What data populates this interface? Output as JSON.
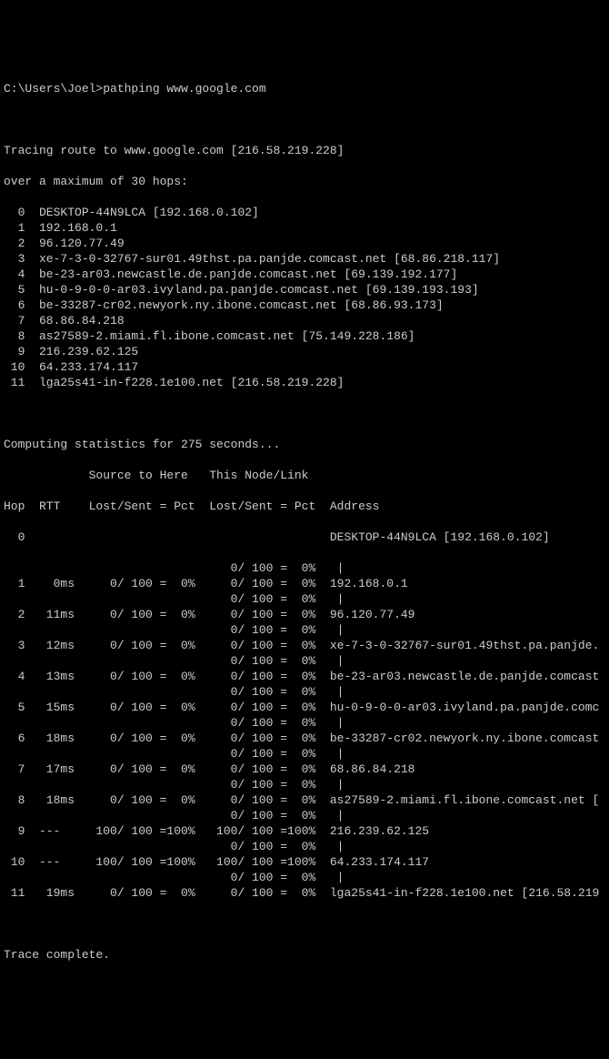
{
  "prompt": "C:\\Users\\Joel>pathping www.google.com",
  "trace_header": "Tracing route to www.google.com [216.58.219.228]",
  "maxhops": "over a maximum of 30 hops:",
  "trace_hops": [
    {
      "n": "  0",
      "text": "DESKTOP-44N9LCA [192.168.0.102]"
    },
    {
      "n": "  1",
      "text": "192.168.0.1"
    },
    {
      "n": "  2",
      "text": "96.120.77.49"
    },
    {
      "n": "  3",
      "text": "xe-7-3-0-32767-sur01.49thst.pa.panjde.comcast.net [68.86.218.117]"
    },
    {
      "n": "  4",
      "text": "be-23-ar03.newcastle.de.panjde.comcast.net [69.139.192.177]"
    },
    {
      "n": "  5",
      "text": "hu-0-9-0-0-ar03.ivyland.pa.panjde.comcast.net [69.139.193.193]"
    },
    {
      "n": "  6",
      "text": "be-33287-cr02.newyork.ny.ibone.comcast.net [68.86.93.173]"
    },
    {
      "n": "  7",
      "text": "68.86.84.218"
    },
    {
      "n": "  8",
      "text": "as27589-2.miami.fl.ibone.comcast.net [75.149.228.186]"
    },
    {
      "n": "  9",
      "text": "216.239.62.125"
    },
    {
      "n": " 10",
      "text": "64.233.174.117"
    },
    {
      "n": " 11",
      "text": "lga25s41-in-f228.1e100.net [216.58.219.228]"
    }
  ],
  "stats_header": "Computing statistics for 275 seconds...",
  "col_header1": "            Source to Here   This Node/Link",
  "col_header2": "Hop  RTT    Lost/Sent = Pct  Lost/Sent = Pct  Address",
  "hop0_line": "  0                                           DESKTOP-44N9LCA [192.168.0.102]",
  "rows": [
    {
      "link": "                                0/ 100 =  0%   |",
      "hop": "  1    0ms     0/ 100 =  0%     0/ 100 =  0%  192.168.0.1"
    },
    {
      "link": "                                0/ 100 =  0%   |",
      "hop": "  2   11ms     0/ 100 =  0%     0/ 100 =  0%  96.120.77.49"
    },
    {
      "link": "                                0/ 100 =  0%   |",
      "hop": "  3   12ms     0/ 100 =  0%     0/ 100 =  0%  xe-7-3-0-32767-sur01.49thst.pa.panjde."
    },
    {
      "link": "                                0/ 100 =  0%   |",
      "hop": "  4   13ms     0/ 100 =  0%     0/ 100 =  0%  be-23-ar03.newcastle.de.panjde.comcast"
    },
    {
      "link": "                                0/ 100 =  0%   |",
      "hop": "  5   15ms     0/ 100 =  0%     0/ 100 =  0%  hu-0-9-0-0-ar03.ivyland.pa.panjde.comc"
    },
    {
      "link": "                                0/ 100 =  0%   |",
      "hop": "  6   18ms     0/ 100 =  0%     0/ 100 =  0%  be-33287-cr02.newyork.ny.ibone.comcast"
    },
    {
      "link": "                                0/ 100 =  0%   |",
      "hop": "  7   17ms     0/ 100 =  0%     0/ 100 =  0%  68.86.84.218"
    },
    {
      "link": "                                0/ 100 =  0%   |",
      "hop": "  8   18ms     0/ 100 =  0%     0/ 100 =  0%  as27589-2.miami.fl.ibone.comcast.net ["
    },
    {
      "link": "                                0/ 100 =  0%   |",
      "hop": "  9  ---     100/ 100 =100%   100/ 100 =100%  216.239.62.125"
    },
    {
      "link": "                                0/ 100 =  0%   |",
      "hop": " 10  ---     100/ 100 =100%   100/ 100 =100%  64.233.174.117"
    },
    {
      "link": "                                0/ 100 =  0%   |",
      "hop": " 11   19ms     0/ 100 =  0%     0/ 100 =  0%  lga25s41-in-f228.1e100.net [216.58.219"
    }
  ],
  "trace_complete": "Trace complete."
}
